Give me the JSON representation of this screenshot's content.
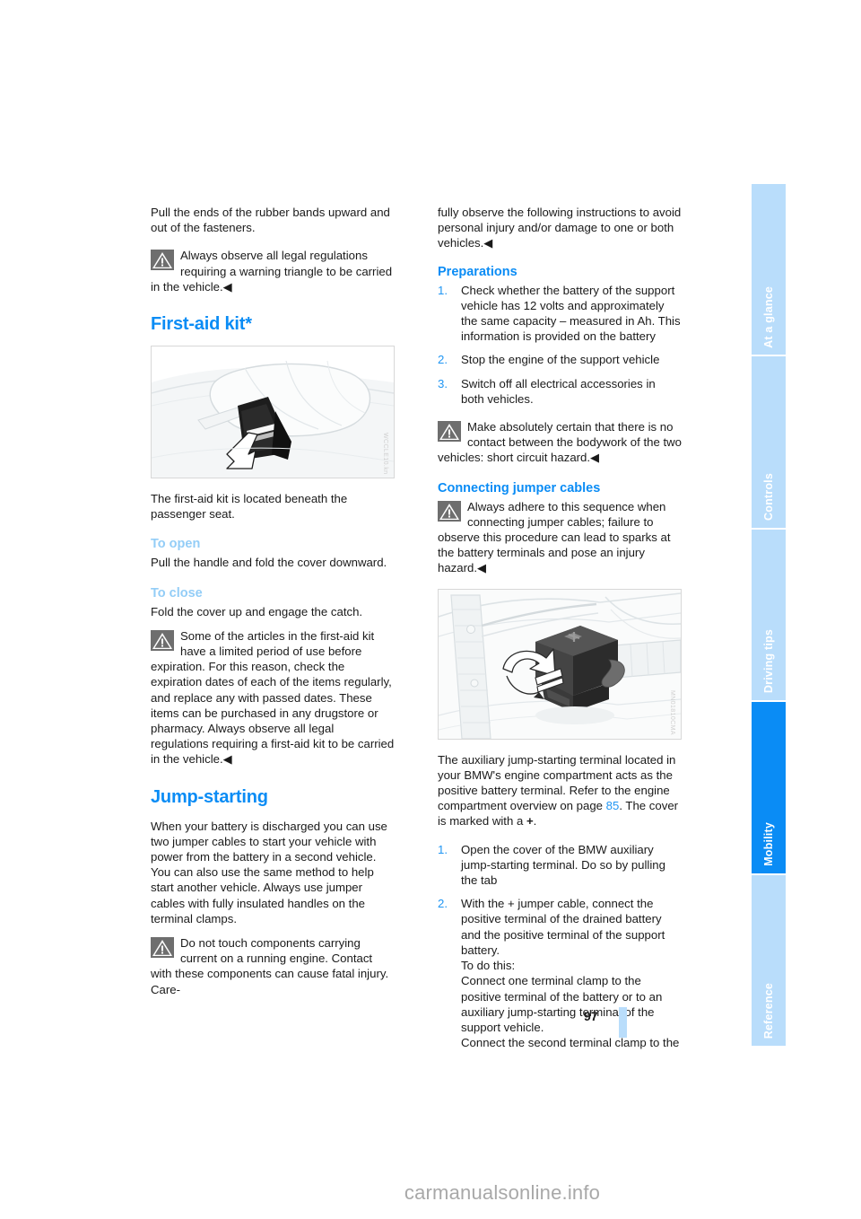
{
  "page": {
    "number": "97",
    "watermark": "carmanualsonline.info"
  },
  "tabs": [
    {
      "label": "At a glance",
      "active": false
    },
    {
      "label": "Controls",
      "active": false
    },
    {
      "label": "Driving tips",
      "active": false
    },
    {
      "label": "Mobility",
      "active": true
    },
    {
      "label": "Reference",
      "active": false
    }
  ],
  "left_column": {
    "intro_para": "Pull the ends of the rubber bands upward and out of the fasteners.",
    "warning_1": "Always observe all legal regulations requiring a warning triangle to be carried in the vehicle.◀",
    "heading_first_aid": "First-aid kit*",
    "figure_first_aid_code": "WCCLE10.kn",
    "first_aid_location": "The first-aid kit is located beneath the passenger seat.",
    "subheading_to_open": "To open",
    "to_open_text": "Pull the handle and fold the cover downward.",
    "subheading_to_close": "To close",
    "to_close_text": "Fold the cover up and engage the catch.",
    "warning_2": "Some of the articles in the first-aid kit have a limited period of use before expiration. For this reason, check the expiration dates of each of the items regularly, and replace any with passed dates. These items can be purchased in any drugstore or pharmacy. Always observe all legal regulations requiring a first-aid kit to be carried in the vehicle.◀",
    "heading_jump_starting": "Jump-starting",
    "jump_start_para": "When your battery is discharged you can use two jumper cables to start your vehicle with power from the battery in a second vehicle. You can also use the same method to help start another vehicle. Always use jumper cables with fully insulated handles on the terminal clamps.",
    "warning_3": "Do not touch components carrying current on a running engine. Contact with these components can cause fatal injury. Care-"
  },
  "right_column": {
    "continuation_para": "fully observe the following instructions to avoid personal injury and/or damage to one or both vehicles.◀",
    "heading_preparations": "Preparations",
    "preparations_steps": [
      {
        "num": "1.",
        "text": "Check whether the battery of the support vehicle has 12 volts and approximately the same capacity – measured in Ah. This information is provided on the battery"
      },
      {
        "num": "2.",
        "text": "Stop the engine of the support vehicle"
      },
      {
        "num": "3.",
        "text": "Switch off all electrical accessories in both vehicles."
      }
    ],
    "warning_4": "Make absolutely certain that there is no contact between the bodywork of the two vehicles: short circuit hazard.◀",
    "heading_connecting": "Connecting jumper cables",
    "warning_5": "Always adhere to this sequence when connecting jumper cables; failure to observe this procedure can lead to sparks at the battery terminals and pose an injury hazard.◀",
    "figure_jump_code": "MN01810CMA",
    "aux_terminal_para_1": "The auxiliary jump-starting terminal located in your BMW's engine compartment acts as the positive battery terminal. Refer to the engine compartment overview on page ",
    "aux_terminal_page_ref": "85",
    "aux_terminal_para_2": ". The cover is marked with a ",
    "aux_terminal_plus": "+",
    "aux_terminal_para_3": ".",
    "connecting_steps": [
      {
        "num": "1.",
        "text": "Open the cover of the BMW auxiliary jump-starting terminal. Do so by pulling the tab"
      },
      {
        "num": "2.",
        "text": "With the + jumper cable, connect the positive terminal of the drained battery and the positive terminal of the support battery.\nTo do this:\nConnect one terminal clamp to the positive terminal of the battery or to an auxiliary jump-starting terminal of the support vehicle.\nConnect the second terminal clamp to the"
      }
    ]
  },
  "colors": {
    "heading_blue": "#0a8cf5",
    "subheading_light_blue": "#93cdf7",
    "tab_inactive": "#b9ddfb",
    "tab_active": "#0a8cf5",
    "list_number_blue": "#2196f3"
  }
}
